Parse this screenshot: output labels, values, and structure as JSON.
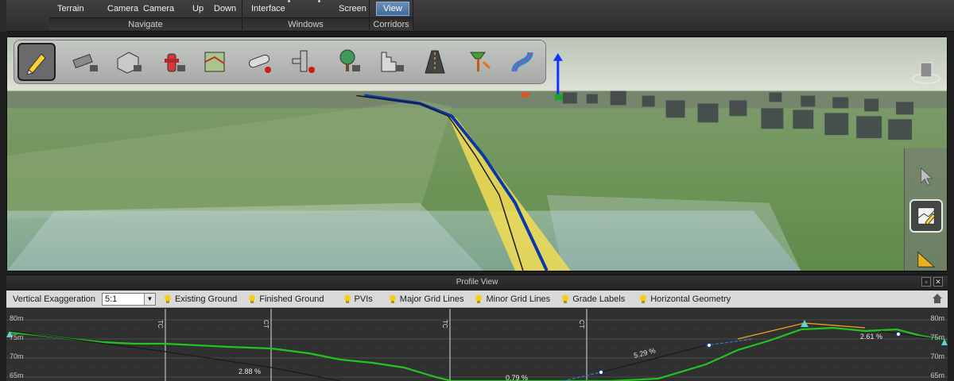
{
  "ribbon": {
    "groups": [
      {
        "name": "Navigate",
        "buttons": [
          "Terrain",
          "Camera",
          "Camera",
          "Up",
          "Down"
        ]
      },
      {
        "name": "Windows",
        "buttons": [
          "Interface",
          "Screen"
        ]
      },
      {
        "name": "Corridors",
        "buttons": [
          "View"
        ]
      }
    ]
  },
  "colors": {
    "accent": "#4a78aa",
    "profile_ground": "#22c51e",
    "proposed_line": "#1a1a1a",
    "alignment_blue": "#0a38a8",
    "corridor_yellow": "#f2dc55"
  },
  "tool_palette": {
    "icons": [
      "pencil-edit-icon",
      "pipe-segment-icon",
      "building-icon",
      "fire-hydrant-icon",
      "land-parcel-icon",
      "pipe-icon",
      "pipe-connector-icon",
      "tree-icon",
      "stairs-icon",
      "road-icon",
      "signal-icon",
      "road-curve-icon"
    ]
  },
  "right_tools": {
    "icons": [
      "select-cursor-icon",
      "profile-edit-icon",
      "ruler-triangle-icon"
    ]
  },
  "profile": {
    "title": "Profile View",
    "vertical_exaggeration_label": "Vertical Exaggeration",
    "vertical_exaggeration_value": "5:1",
    "toggles": [
      "Existing Ground",
      "Finished Ground",
      "PVIs",
      "Major Grid Lines",
      "Minor Grid Lines",
      "Grade Labels",
      "Horizontal Geometry"
    ],
    "y_labels": [
      "80m",
      "75m",
      "70m",
      "65m"
    ],
    "grade_labels": [
      "2.88 %",
      "5.29 %",
      "2.61 %",
      "0.79 %"
    ],
    "station_markers": [
      "TC",
      "CT",
      "TC",
      "CT"
    ]
  }
}
